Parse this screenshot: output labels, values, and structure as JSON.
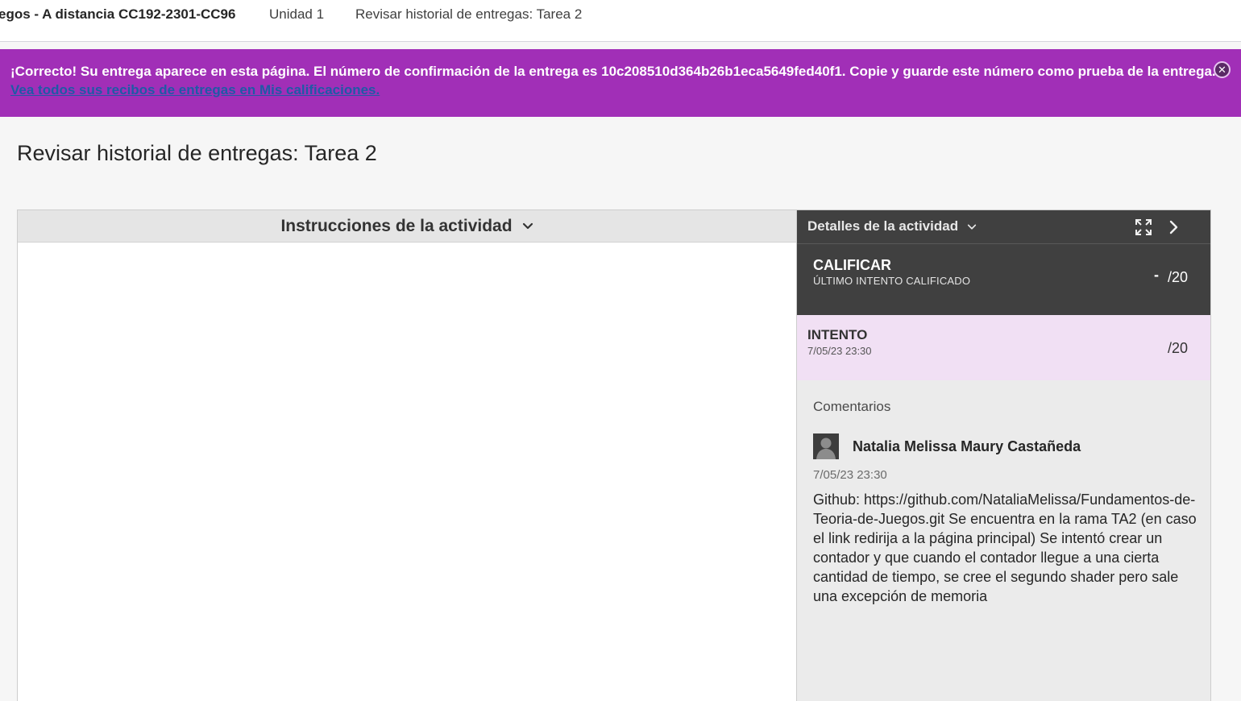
{
  "breadcrumb": {
    "course": "egos - A distancia CC192-2301-CC96",
    "unit": "Unidad 1",
    "current": "Revisar historial de entregas: Tarea 2"
  },
  "banner": {
    "message": "¡Correcto! Su entrega aparece en esta página. El número de confirmación de la entrega es 10c208510d364b26b1eca5649fed40f1. Copie y guarde este número como prueba de la entrega.",
    "link_text": "Vea todos sus recibos de entregas en Mis calificaciones.",
    "close_glyph": "✕",
    "background": "#a12fb7"
  },
  "page": {
    "title": "Revisar historial de entregas: Tarea 2"
  },
  "instructions": {
    "header": "Instrucciones de la actividad"
  },
  "details": {
    "header": "Detalles de la actividad",
    "grade": {
      "title": "CALIFICAR",
      "subtitle": "ÚLTIMO INTENTO CALIFICADO",
      "value": "-",
      "total": "/20"
    },
    "attempt": {
      "title": "INTENTO",
      "date": "7/05/23 23:30",
      "total": "/20",
      "background": "#f1e0f4"
    },
    "comments": {
      "label": "Comentarios",
      "author": "Natalia Melissa Maury Castañeda",
      "date": "7/05/23 23:30",
      "text": "Github: https://github.com/NataliaMelissa/Fundamentos-de-Teoria-de-Juegos.git Se encuentra en la rama TA2 (en caso el link redirija a la página principal) Se intentó crear un contador y que cuando el contador llegue a una cierta cantidad de tiempo, se cree el segundo shader pero sale una excepción de memoria"
    }
  },
  "icons": {
    "chevron": "chevron-down-icon",
    "expand": "expand-icon",
    "next": "chevron-right-icon",
    "close": "close-icon",
    "avatar": "user-avatar-icon"
  }
}
